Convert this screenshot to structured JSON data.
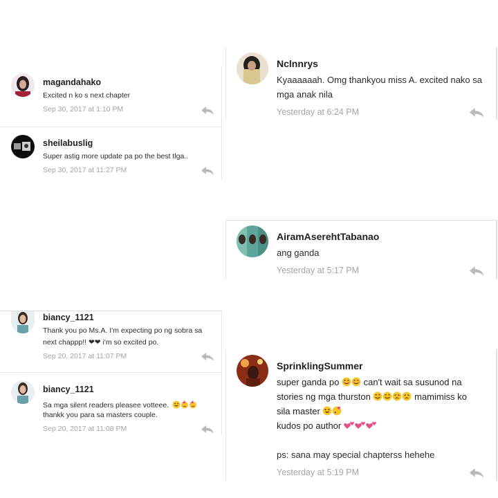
{
  "colors": {
    "timestamp": "#a4a4a4",
    "reply_icon": "#b9b9b9",
    "divider": "#e7e7e7",
    "heart_pink": "#e64f8c",
    "emoji_yellow": "#f7c52b"
  },
  "comments": [
    {
      "username": "magandahako",
      "lines": [
        "Excited n ko s next chapter"
      ],
      "timestamp": "Sep 30, 2017 at 1:10 PM"
    },
    {
      "username": "sheilabuslig",
      "lines": [
        "Super astig more update pa po the best tlga.."
      ],
      "timestamp": "Sep 30, 2017 at 11:27 PM"
    },
    {
      "username": "biancy_1121",
      "lines": [
        "Thank you po Ms.A. I'm expecting po ng sobra sa",
        "next chappp!! ❤❤ i'm so excited po."
      ],
      "timestamp": "Sep 20, 2017 at 11:07 PM"
    },
    {
      "username": "biancy_1121",
      "lines": [
        "Sa mga silent readers pleasee votteee.",
        "thankk you para sa masters couple."
      ],
      "timestamp": "Sep 20, 2017 at 11:08 PM"
    },
    {
      "username": "Nclnnrys",
      "lines": [
        "Kyaaaaaah. Omg thankyou miss A. excited nako sa",
        "mga anak nila"
      ],
      "timestamp": "Yesterday at 6:24 PM"
    },
    {
      "username": "AiramAserehtTabanao",
      "lines": [
        "ang ganda"
      ],
      "timestamp": "Yesterday at 5:17 PM"
    },
    {
      "username": "SprinklingSummer",
      "lines": [
        "super ganda po",
        "can't wait sa  susunod na",
        "stories ng mga thurston",
        "mamimiss ko",
        "sila master",
        "kudos po author",
        "ps: sana may special chapterss hehehe"
      ],
      "timestamp": "Yesterday at 5:19 PM"
    }
  ]
}
